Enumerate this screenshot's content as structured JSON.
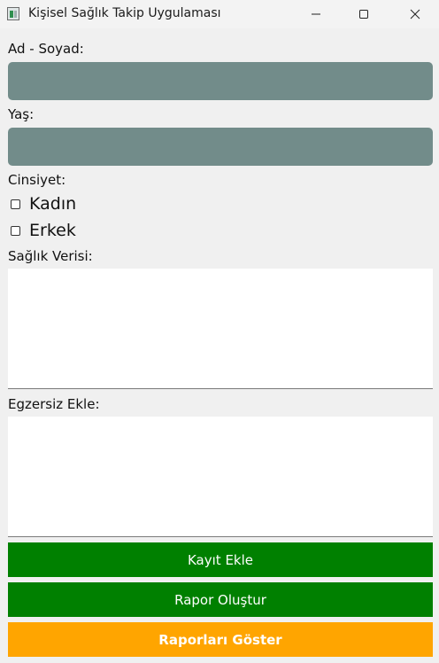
{
  "window": {
    "title": "Kişisel Sağlık Takip Uygulaması",
    "icons": {
      "app": "app-window-icon",
      "minimize": "minimize-icon",
      "maximize": "maximize-icon",
      "close": "close-icon"
    }
  },
  "form": {
    "name_label": "Ad - Soyad:",
    "name_value": "",
    "age_label": "Yaş:",
    "age_value": "",
    "gender_label": "Cinsiyet:",
    "gender_options": [
      {
        "label": "Kadın",
        "checked": false
      },
      {
        "label": "Erkek",
        "checked": false
      }
    ],
    "health_label": "Sağlık Verisi:",
    "health_value": "",
    "exercise_label": "Egzersiz Ekle:",
    "exercise_value": ""
  },
  "buttons": {
    "add_record": "Kayıt Ekle",
    "create_report": "Rapor Oluştur",
    "show_reports": "Raporları Göster"
  },
  "colors": {
    "input_bg": "#728c8a",
    "primary_green": "#008000",
    "accent_orange": "#ffa500"
  }
}
